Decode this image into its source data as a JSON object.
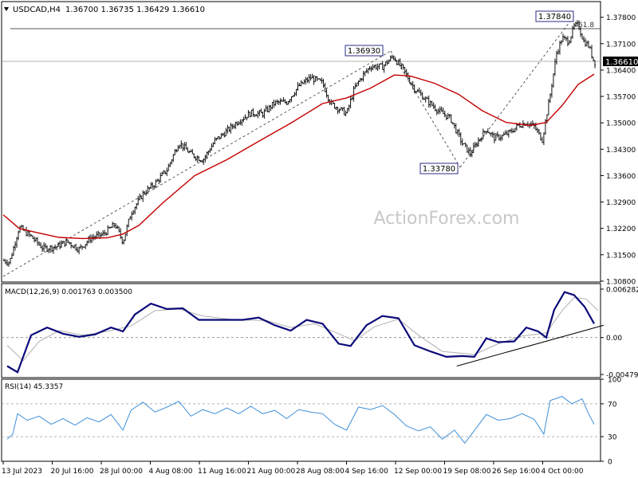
{
  "header": {
    "symbol": "USDCAD,H4",
    "ohlc": "1.36700 1.36735 1.36429 1.36610"
  },
  "watermark": "ActionForex.com",
  "chart_data": [
    {
      "type": "candlestick",
      "panel": "price",
      "ylim": [
        1.30777,
        1.38216
      ],
      "y_ticks": [
        "1.37800",
        "1.37100",
        "1.36400",
        "1.35700",
        "1.35000",
        "1.34300",
        "1.33600",
        "1.32900",
        "1.32200",
        "1.31500",
        "1.30800"
      ],
      "x_ticks": [
        "13 Jul 2023",
        "20 Jul 16:00",
        "28 Jul 00:00",
        "4 Aug 08:00",
        "11 Aug 16:00",
        "21 Aug 00:00",
        "28 Aug 08:00",
        "4 Sep 16:00",
        "12 Sep 00:00",
        "19 Sep 08:00",
        "26 Sep 16:00",
        "4 Oct 00:00"
      ],
      "current_price": "1.36610",
      "price_callouts": [
        "1.37840",
        "1.36930",
        "1.33780"
      ],
      "fib_label": "61.8",
      "close_points": [
        {
          "x": 0,
          "y": 1.3135
        },
        {
          "x": 8,
          "y": 1.313
        },
        {
          "x": 20,
          "y": 1.3223
        },
        {
          "x": 35,
          "y": 1.3198
        },
        {
          "x": 50,
          "y": 1.3167
        },
        {
          "x": 65,
          "y": 1.317
        },
        {
          "x": 80,
          "y": 1.3185
        },
        {
          "x": 95,
          "y": 1.3165
        },
        {
          "x": 110,
          "y": 1.3195
        },
        {
          "x": 125,
          "y": 1.3204
        },
        {
          "x": 140,
          "y": 1.3231
        },
        {
          "x": 150,
          "y": 1.3184
        },
        {
          "x": 160,
          "y": 1.3261
        },
        {
          "x": 175,
          "y": 1.3312
        },
        {
          "x": 190,
          "y": 1.3339
        },
        {
          "x": 205,
          "y": 1.3375
        },
        {
          "x": 220,
          "y": 1.3448
        },
        {
          "x": 235,
          "y": 1.3417
        },
        {
          "x": 250,
          "y": 1.3401
        },
        {
          "x": 265,
          "y": 1.3452
        },
        {
          "x": 280,
          "y": 1.3478
        },
        {
          "x": 295,
          "y": 1.3506
        },
        {
          "x": 310,
          "y": 1.3526
        },
        {
          "x": 325,
          "y": 1.3524
        },
        {
          "x": 340,
          "y": 1.3553
        },
        {
          "x": 355,
          "y": 1.3555
        },
        {
          "x": 370,
          "y": 1.3597
        },
        {
          "x": 385,
          "y": 1.362
        },
        {
          "x": 400,
          "y": 1.3605
        },
        {
          "x": 410,
          "y": 1.3552
        },
        {
          "x": 420,
          "y": 1.3538
        },
        {
          "x": 430,
          "y": 1.3524
        },
        {
          "x": 440,
          "y": 1.3592
        },
        {
          "x": 450,
          "y": 1.3625
        },
        {
          "x": 460,
          "y": 1.365
        },
        {
          "x": 475,
          "y": 1.3649
        },
        {
          "x": 488,
          "y": 1.3676
        },
        {
          "x": 500,
          "y": 1.3644
        },
        {
          "x": 515,
          "y": 1.3591
        },
        {
          "x": 530,
          "y": 1.356
        },
        {
          "x": 545,
          "y": 1.3532
        },
        {
          "x": 560,
          "y": 1.3512
        },
        {
          "x": 575,
          "y": 1.3445
        },
        {
          "x": 585,
          "y": 1.3418
        },
        {
          "x": 595,
          "y": 1.3453
        },
        {
          "x": 605,
          "y": 1.3483
        },
        {
          "x": 615,
          "y": 1.346
        },
        {
          "x": 625,
          "y": 1.3465
        },
        {
          "x": 635,
          "y": 1.3475
        },
        {
          "x": 645,
          "y": 1.3493
        },
        {
          "x": 655,
          "y": 1.3501
        },
        {
          "x": 665,
          "y": 1.349
        },
        {
          "x": 675,
          "y": 1.3455
        },
        {
          "x": 685,
          "y": 1.3575
        },
        {
          "x": 693,
          "y": 1.3685
        },
        {
          "x": 700,
          "y": 1.3725
        },
        {
          "x": 708,
          "y": 1.3716
        },
        {
          "x": 715,
          "y": 1.3755
        },
        {
          "x": 720,
          "y": 1.376
        },
        {
          "x": 727,
          "y": 1.3716
        },
        {
          "x": 733,
          "y": 1.3705
        },
        {
          "x": 740,
          "y": 1.3661
        }
      ],
      "ma_points": [
        {
          "x": 0,
          "y": 1.3256
        },
        {
          "x": 20,
          "y": 1.322
        },
        {
          "x": 40,
          "y": 1.321
        },
        {
          "x": 70,
          "y": 1.3196
        },
        {
          "x": 100,
          "y": 1.3193
        },
        {
          "x": 130,
          "y": 1.3195
        },
        {
          "x": 150,
          "y": 1.3205
        },
        {
          "x": 170,
          "y": 1.3228
        },
        {
          "x": 200,
          "y": 1.3288
        },
        {
          "x": 240,
          "y": 1.336
        },
        {
          "x": 280,
          "y": 1.3402
        },
        {
          "x": 320,
          "y": 1.3451
        },
        {
          "x": 360,
          "y": 1.3499
        },
        {
          "x": 400,
          "y": 1.3551
        },
        {
          "x": 430,
          "y": 1.3566
        },
        {
          "x": 460,
          "y": 1.3592
        },
        {
          "x": 490,
          "y": 1.3627
        },
        {
          "x": 510,
          "y": 1.3624
        },
        {
          "x": 540,
          "y": 1.3605
        },
        {
          "x": 570,
          "y": 1.3576
        },
        {
          "x": 600,
          "y": 1.3532
        },
        {
          "x": 630,
          "y": 1.3501
        },
        {
          "x": 660,
          "y": 1.3493
        },
        {
          "x": 680,
          "y": 1.3501
        },
        {
          "x": 700,
          "y": 1.3546
        },
        {
          "x": 720,
          "y": 1.3602
        },
        {
          "x": 740,
          "y": 1.3629
        }
      ]
    },
    {
      "type": "line",
      "panel": "macd",
      "label": "MACD(12,26,9) 0.001763 0.003500",
      "ylim": [
        -0.0052,
        0.007
      ],
      "y_ticks": [
        "0.006282",
        "0.00",
        "-0.004795"
      ],
      "macd_points": [
        {
          "x": 5,
          "y": -0.0037
        },
        {
          "x": 18,
          "y": -0.0045
        },
        {
          "x": 35,
          "y": 0.0003
        },
        {
          "x": 55,
          "y": 0.0013
        },
        {
          "x": 75,
          "y": 0.0005
        },
        {
          "x": 95,
          "y": 0.0001
        },
        {
          "x": 115,
          "y": 0.0004
        },
        {
          "x": 135,
          "y": 0.0013
        },
        {
          "x": 150,
          "y": 0.0008
        },
        {
          "x": 165,
          "y": 0.003
        },
        {
          "x": 185,
          "y": 0.0044
        },
        {
          "x": 205,
          "y": 0.0037
        },
        {
          "x": 225,
          "y": 0.0038
        },
        {
          "x": 245,
          "y": 0.0023
        },
        {
          "x": 270,
          "y": 0.0023
        },
        {
          "x": 300,
          "y": 0.0023
        },
        {
          "x": 320,
          "y": 0.0026
        },
        {
          "x": 340,
          "y": 0.0016
        },
        {
          "x": 360,
          "y": 0.0009
        },
        {
          "x": 380,
          "y": 0.0023
        },
        {
          "x": 400,
          "y": 0.0018
        },
        {
          "x": 420,
          "y": -0.0008
        },
        {
          "x": 435,
          "y": -0.0011
        },
        {
          "x": 455,
          "y": 0.0016
        },
        {
          "x": 475,
          "y": 0.0028
        },
        {
          "x": 495,
          "y": 0.0025
        },
        {
          "x": 515,
          "y": -0.001
        },
        {
          "x": 535,
          "y": -0.0018
        },
        {
          "x": 555,
          "y": -0.0025
        },
        {
          "x": 575,
          "y": -0.0024
        },
        {
          "x": 590,
          "y": -0.0025
        },
        {
          "x": 605,
          "y": -0.0001
        },
        {
          "x": 620,
          "y": -0.0006
        },
        {
          "x": 640,
          "y": -0.0005
        },
        {
          "x": 655,
          "y": 0.0013
        },
        {
          "x": 670,
          "y": 0.0008
        },
        {
          "x": 680,
          "y": 0.0
        },
        {
          "x": 690,
          "y": 0.0036
        },
        {
          "x": 703,
          "y": 0.0059
        },
        {
          "x": 715,
          "y": 0.0055
        },
        {
          "x": 728,
          "y": 0.004
        },
        {
          "x": 740,
          "y": 0.0018
        }
      ],
      "signal_points": [
        {
          "x": 5,
          "y": -0.001
        },
        {
          "x": 25,
          "y": -0.003
        },
        {
          "x": 45,
          "y": -0.0005
        },
        {
          "x": 70,
          "y": 0.0009
        },
        {
          "x": 100,
          "y": 0.0003
        },
        {
          "x": 130,
          "y": 0.0008
        },
        {
          "x": 160,
          "y": 0.0015
        },
        {
          "x": 190,
          "y": 0.0035
        },
        {
          "x": 220,
          "y": 0.0037
        },
        {
          "x": 250,
          "y": 0.0028
        },
        {
          "x": 290,
          "y": 0.0023
        },
        {
          "x": 330,
          "y": 0.0022
        },
        {
          "x": 360,
          "y": 0.0013
        },
        {
          "x": 390,
          "y": 0.0018
        },
        {
          "x": 420,
          "y": 0.0005
        },
        {
          "x": 440,
          "y": -0.0004
        },
        {
          "x": 465,
          "y": 0.0014
        },
        {
          "x": 495,
          "y": 0.0024
        },
        {
          "x": 520,
          "y": 0.0003
        },
        {
          "x": 550,
          "y": -0.0018
        },
        {
          "x": 590,
          "y": -0.0022
        },
        {
          "x": 620,
          "y": -0.0008
        },
        {
          "x": 650,
          "y": 0.0002
        },
        {
          "x": 680,
          "y": 0.0006
        },
        {
          "x": 700,
          "y": 0.0035
        },
        {
          "x": 715,
          "y": 0.0052
        },
        {
          "x": 730,
          "y": 0.005
        },
        {
          "x": 745,
          "y": 0.0035
        }
      ],
      "trendline": [
        {
          "x": 568,
          "y": -0.0037
        },
        {
          "x": 752,
          "y": 0.0016
        }
      ]
    },
    {
      "type": "line",
      "panel": "rsi",
      "label": "RSI(14) 45.3357",
      "ylim": [
        0,
        100
      ],
      "y_ticks": [
        "100",
        "70",
        "30",
        "0"
      ],
      "levels": [
        70,
        30
      ],
      "rsi_points": [
        {
          "x": 5,
          "y": 27
        },
        {
          "x": 12,
          "y": 33
        },
        {
          "x": 18,
          "y": 58
        },
        {
          "x": 30,
          "y": 50
        },
        {
          "x": 45,
          "y": 55
        },
        {
          "x": 60,
          "y": 45
        },
        {
          "x": 75,
          "y": 52
        },
        {
          "x": 90,
          "y": 44
        },
        {
          "x": 105,
          "y": 53
        },
        {
          "x": 120,
          "y": 48
        },
        {
          "x": 135,
          "y": 57
        },
        {
          "x": 150,
          "y": 38
        },
        {
          "x": 160,
          "y": 62
        },
        {
          "x": 175,
          "y": 72
        },
        {
          "x": 190,
          "y": 60
        },
        {
          "x": 205,
          "y": 66
        },
        {
          "x": 220,
          "y": 73
        },
        {
          "x": 235,
          "y": 55
        },
        {
          "x": 250,
          "y": 63
        },
        {
          "x": 265,
          "y": 58
        },
        {
          "x": 280,
          "y": 65
        },
        {
          "x": 295,
          "y": 58
        },
        {
          "x": 310,
          "y": 67
        },
        {
          "x": 325,
          "y": 58
        },
        {
          "x": 340,
          "y": 62
        },
        {
          "x": 355,
          "y": 52
        },
        {
          "x": 370,
          "y": 63
        },
        {
          "x": 385,
          "y": 60
        },
        {
          "x": 400,
          "y": 58
        },
        {
          "x": 415,
          "y": 45
        },
        {
          "x": 430,
          "y": 38
        },
        {
          "x": 445,
          "y": 66
        },
        {
          "x": 460,
          "y": 63
        },
        {
          "x": 475,
          "y": 68
        },
        {
          "x": 490,
          "y": 57
        },
        {
          "x": 505,
          "y": 43
        },
        {
          "x": 520,
          "y": 37
        },
        {
          "x": 535,
          "y": 42
        },
        {
          "x": 550,
          "y": 27
        },
        {
          "x": 565,
          "y": 38
        },
        {
          "x": 578,
          "y": 22
        },
        {
          "x": 592,
          "y": 40
        },
        {
          "x": 605,
          "y": 57
        },
        {
          "x": 620,
          "y": 50
        },
        {
          "x": 635,
          "y": 52
        },
        {
          "x": 650,
          "y": 58
        },
        {
          "x": 665,
          "y": 51
        },
        {
          "x": 677,
          "y": 33
        },
        {
          "x": 685,
          "y": 74
        },
        {
          "x": 700,
          "y": 79
        },
        {
          "x": 712,
          "y": 70
        },
        {
          "x": 725,
          "y": 76
        },
        {
          "x": 733,
          "y": 58
        },
        {
          "x": 740,
          "y": 45
        }
      ]
    }
  ]
}
